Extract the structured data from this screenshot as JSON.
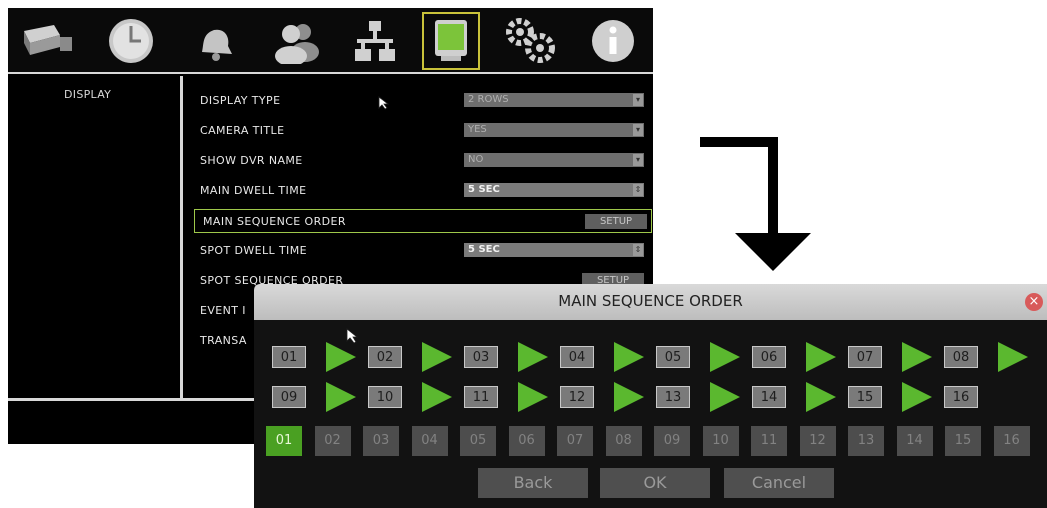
{
  "toolbar": {
    "icons": [
      "camera-icon",
      "clock-icon",
      "bell-icon",
      "users-icon",
      "network-icon",
      "display-icon",
      "gears-icon",
      "info-icon"
    ],
    "active_icon": "display-icon"
  },
  "sidebar": {
    "items": [
      {
        "label": "DISPLAY"
      }
    ]
  },
  "settings": {
    "rows": [
      {
        "label": "DISPLAY TYPE",
        "value": "2 ROWS"
      },
      {
        "label": "CAMERA TITLE",
        "value": "YES"
      },
      {
        "label": "SHOW DVR NAME",
        "value": "NO"
      },
      {
        "label": "MAIN DWELL TIME",
        "value": "5 SEC"
      },
      {
        "label": "MAIN SEQUENCE ORDER",
        "button": "SETUP"
      },
      {
        "label": "SPOT DWELL TIME",
        "value": "5 SEC"
      },
      {
        "label": "SPOT SEQUENCE ORDER",
        "button": "SETUP"
      },
      {
        "label": "EVENT I"
      },
      {
        "label": "TRANSA"
      }
    ]
  },
  "dialog": {
    "title": "MAIN SEQUENCE ORDER",
    "sequence_row1": [
      "01",
      "02",
      "03",
      "04",
      "05",
      "06",
      "07",
      "08"
    ],
    "sequence_row2": [
      "09",
      "10",
      "11",
      "12",
      "13",
      "14",
      "15",
      "16"
    ],
    "channels": [
      "01",
      "02",
      "03",
      "04",
      "05",
      "06",
      "07",
      "08",
      "09",
      "10",
      "11",
      "12",
      "13",
      "14",
      "15",
      "16"
    ],
    "active_channel": "01",
    "buttons": {
      "back": "Back",
      "ok": "OK",
      "cancel": "Cancel"
    },
    "colors": {
      "play": "#5bb82f",
      "active_channel": "#4aa022"
    }
  }
}
